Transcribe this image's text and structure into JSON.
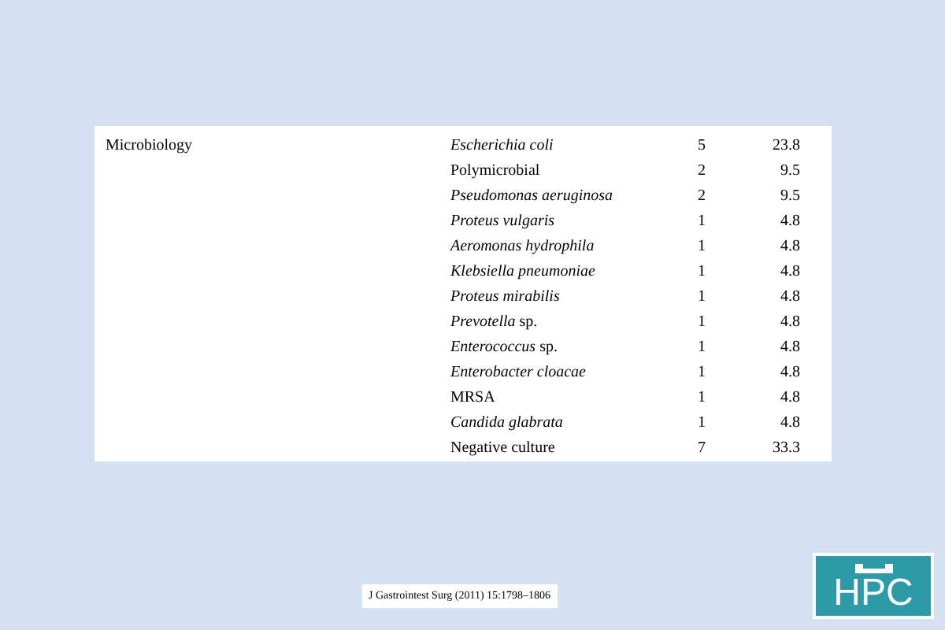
{
  "table": {
    "section": "Microbiology",
    "rows": [
      {
        "organism": "Escherichia coli",
        "italic": true,
        "n": "5",
        "percent": "23.8"
      },
      {
        "organism": "Polymicrobial",
        "italic": false,
        "n": "2",
        "percent": "9.5"
      },
      {
        "organism": "Pseudomonas aeruginosa",
        "italic": true,
        "n": "2",
        "percent": "9.5"
      },
      {
        "organism": "Proteus vulgaris",
        "italic": true,
        "n": "1",
        "percent": "4.8"
      },
      {
        "organism": "Aeromonas hydrophila",
        "italic": true,
        "n": "1",
        "percent": "4.8"
      },
      {
        "organism": "Klebsiella pneumoniae",
        "italic": true,
        "n": "1",
        "percent": "4.8"
      },
      {
        "organism": "Proteus mirabilis",
        "italic": true,
        "n": "1",
        "percent": "4.8"
      },
      {
        "organism": "*Prevotella* sp.",
        "italic": false,
        "n": "1",
        "percent": "4.8"
      },
      {
        "organism": "*Enterococcus* sp.",
        "italic": false,
        "n": "1",
        "percent": "4.8"
      },
      {
        "organism": "Enterobacter cloacae",
        "italic": true,
        "n": "1",
        "percent": "4.8"
      },
      {
        "organism": "MRSA",
        "italic": false,
        "n": "1",
        "percent": "4.8"
      },
      {
        "organism": "Candida glabrata",
        "italic": true,
        "n": "1",
        "percent": "4.8"
      },
      {
        "organism": "Negative culture",
        "italic": false,
        "n": "7",
        "percent": "33.3"
      }
    ]
  },
  "citation": "J Gastrointest Surg (2011) 15:1798–1806",
  "logo": {
    "text": "HPC"
  }
}
